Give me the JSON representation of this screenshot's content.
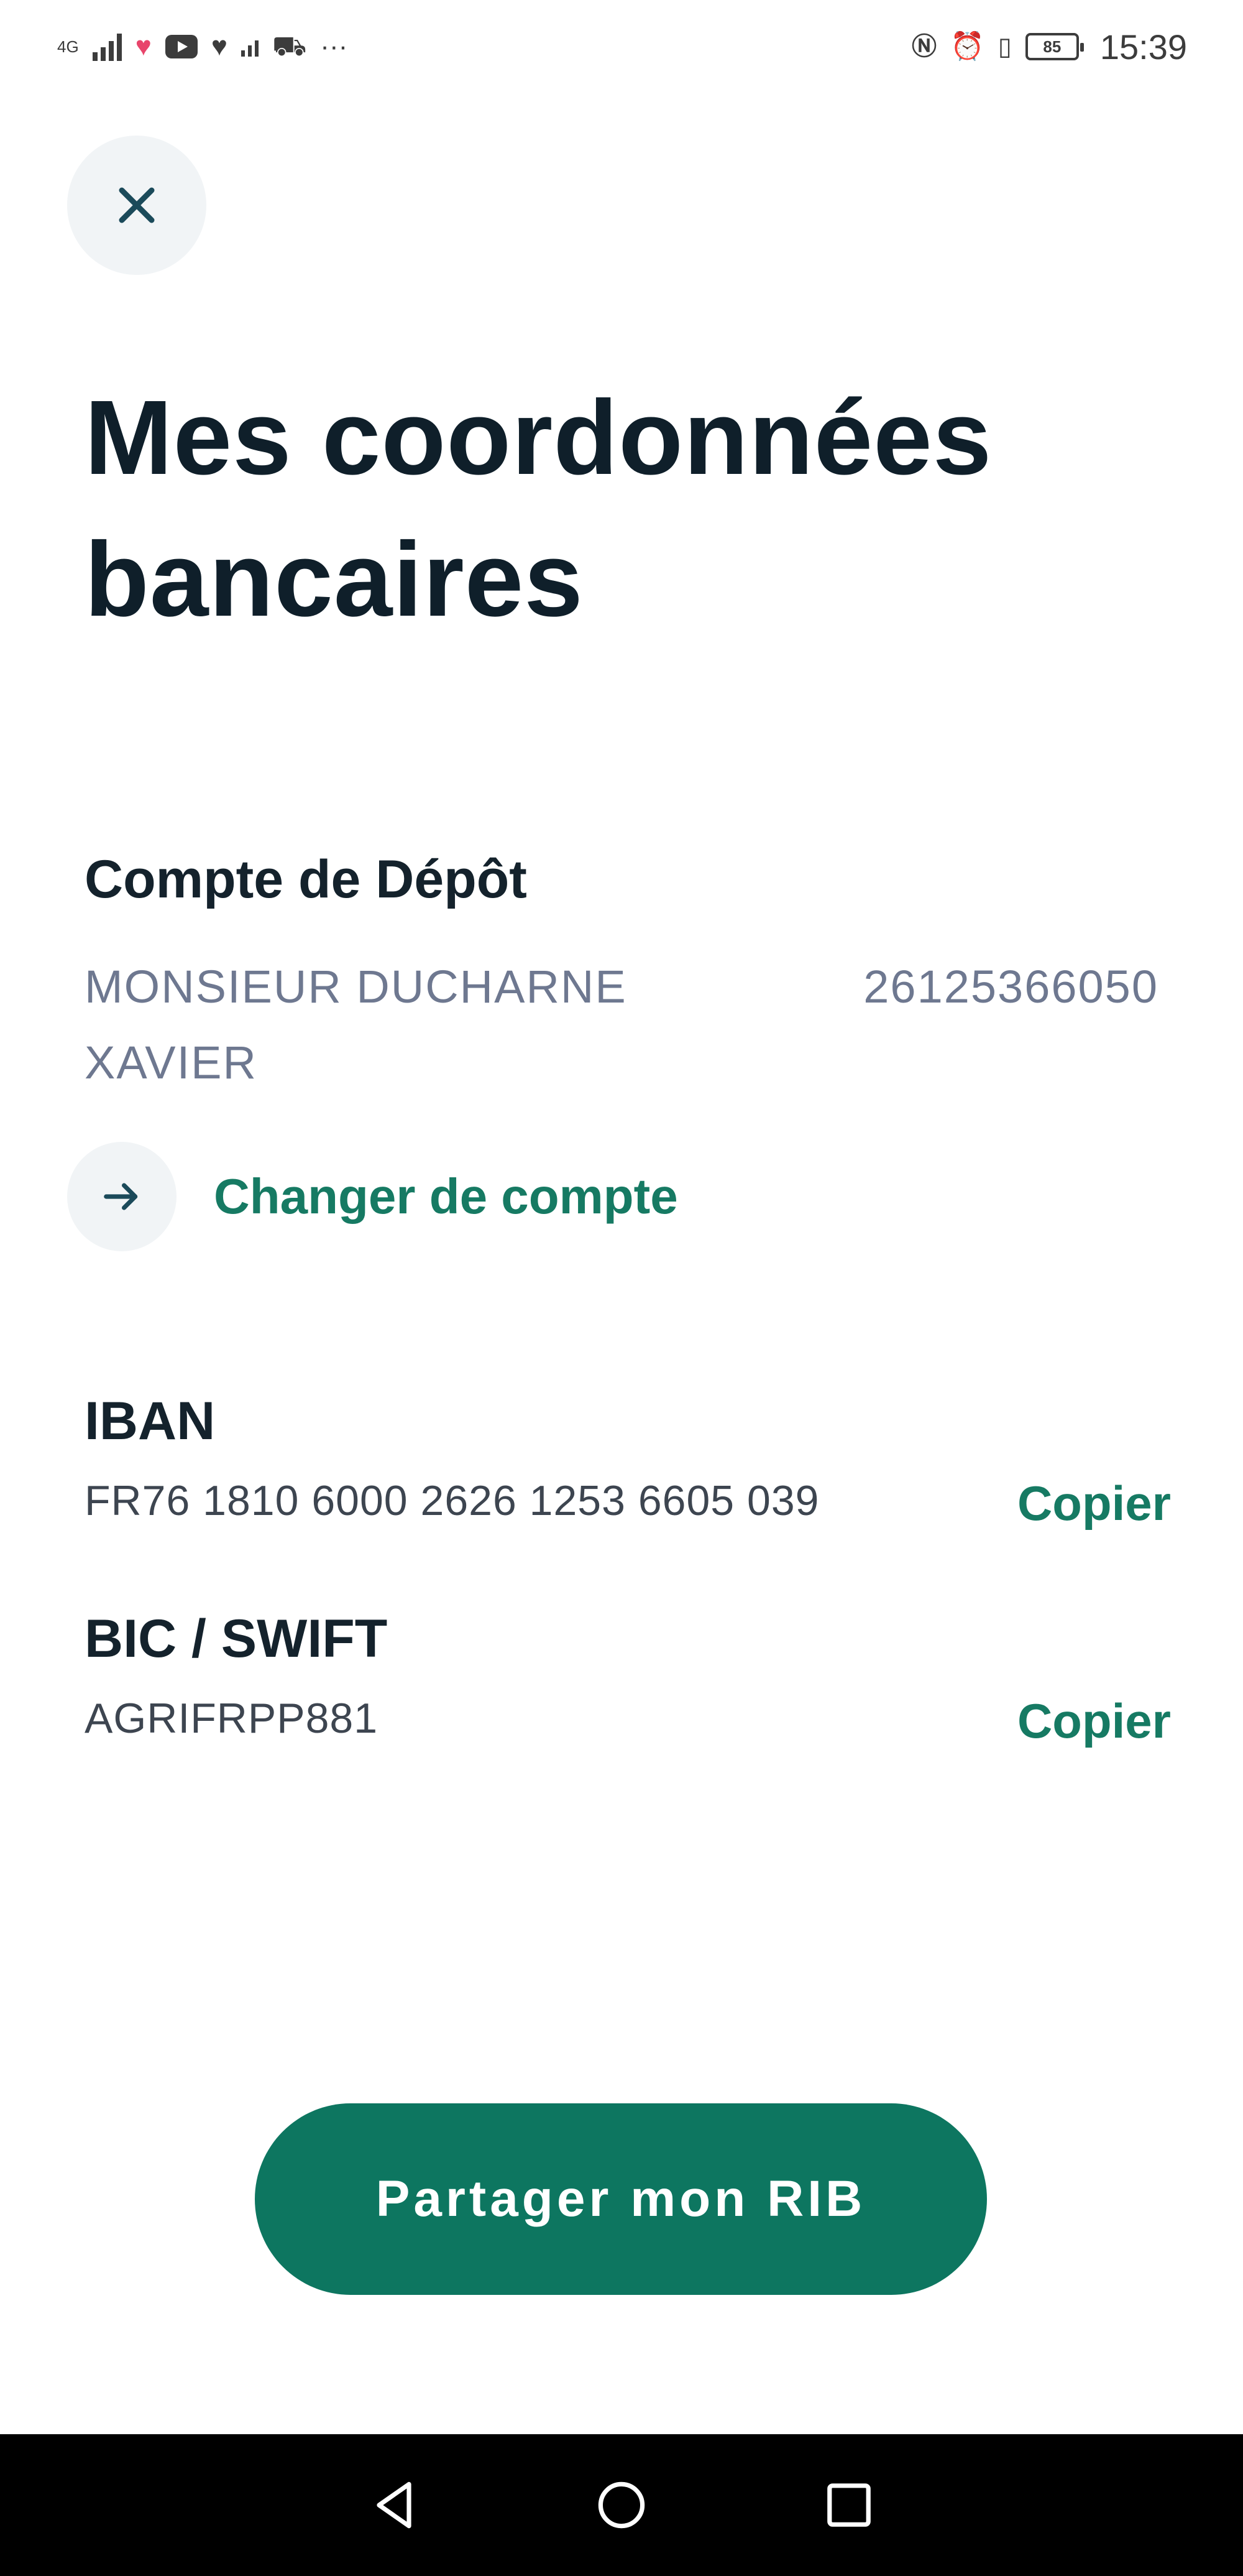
{
  "status_bar": {
    "network": "4G",
    "more": "···",
    "battery": "85",
    "time": "15:39"
  },
  "header": {
    "title": "Mes coordonnées bancaires"
  },
  "account": {
    "type": "Compte de Dépôt",
    "holder": "MONSIEUR DUCHARNE XAVIER",
    "number": "26125366050",
    "change_label": "Changer de compte"
  },
  "fields": [
    {
      "label": "IBAN",
      "value": "FR76 1810 6000 2626 1253 6605 039",
      "copy_label": "Copier"
    },
    {
      "label": "BIC / SWIFT",
      "value": "AGRIFRPP881",
      "copy_label": "Copier"
    }
  ],
  "actions": {
    "share_label": "Partager mon RIB"
  },
  "colors": {
    "accent": "#167a63",
    "button": "#0d7660",
    "title": "#0f1f2a",
    "muted": "#6e7890"
  },
  "icons": {
    "close": "close-icon",
    "arrow": "arrow-right-icon",
    "nav_back": "back-triangle-icon",
    "nav_home": "home-circle-icon",
    "nav_recents": "recents-square-icon"
  }
}
